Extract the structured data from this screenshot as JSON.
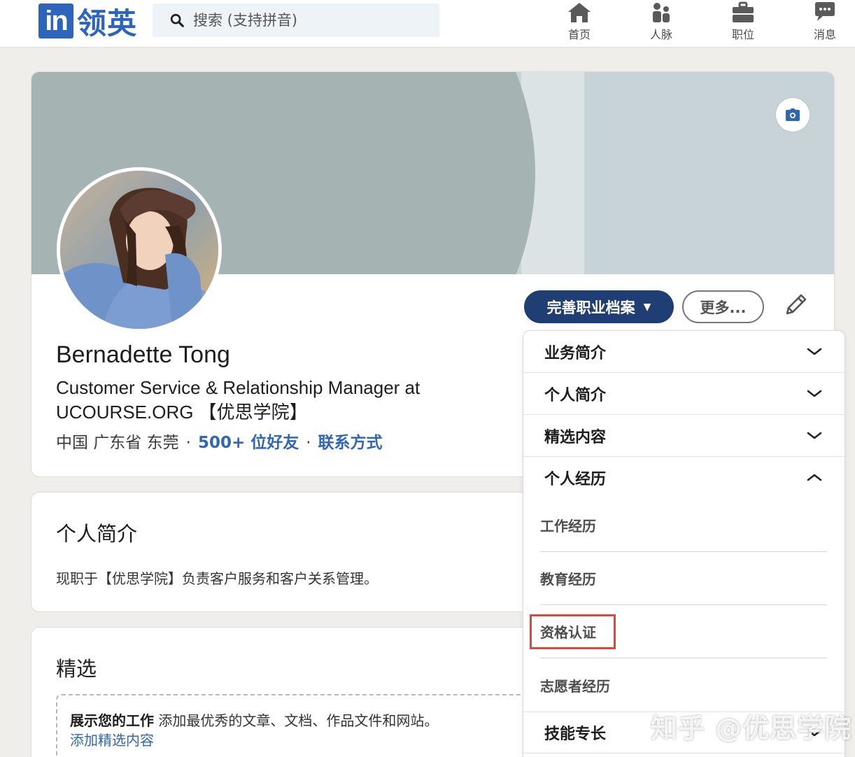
{
  "brand": {
    "logo_mark": "in",
    "logo_text": "领英",
    "color": "#2d64bc"
  },
  "search": {
    "placeholder": "搜索 (支持拼音)"
  },
  "nav": [
    {
      "label": "首页",
      "icon": "home-icon"
    },
    {
      "label": "人脉",
      "icon": "people-icon"
    },
    {
      "label": "职位",
      "icon": "briefcase-icon"
    },
    {
      "label": "消息",
      "icon": "message-icon"
    }
  ],
  "profile": {
    "name": "Bernadette Tong",
    "headline": "Customer Service & Relationship Manager at UCOURSE.ORG 【优思学院】",
    "location": "中国 广东省 东莞",
    "connections": "500+ 位好友",
    "contact": "联系方式",
    "separator": "·"
  },
  "actions": {
    "primary_label": "完善职业档案",
    "more_label": "更多..."
  },
  "about": {
    "title": "个人简介",
    "text": "现职于【优思学院】负责客户服务和客户关系管理。"
  },
  "featured": {
    "title": "精选",
    "heading": "展示您的工作",
    "description": "添加最优秀的文章、文档、作品文件和网站。",
    "link": "添加精选内容"
  },
  "dropdown": {
    "sections": [
      {
        "label": "业务简介",
        "expanded": false
      },
      {
        "label": "个人简介",
        "expanded": false
      },
      {
        "label": "精选内容",
        "expanded": false
      },
      {
        "label": "个人经历",
        "expanded": true
      },
      {
        "label": "技能专长",
        "expanded": false
      }
    ],
    "experience_items": [
      "工作经历",
      "教育经历",
      "资格认证",
      "志愿者经历"
    ],
    "highlighted_item": "资格认证",
    "highlight_color": "#d84a3a"
  },
  "watermark": "知乎 @优思学院"
}
